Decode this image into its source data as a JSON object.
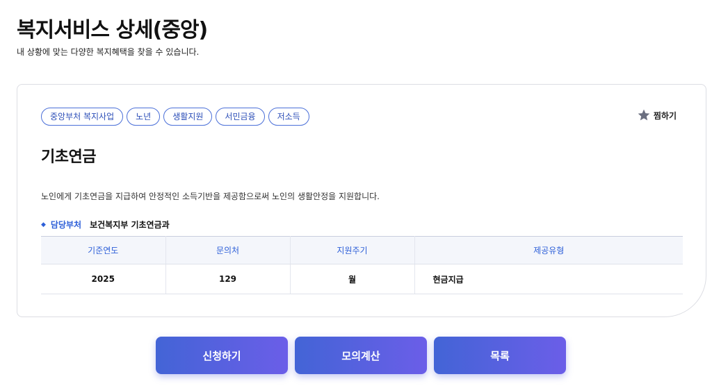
{
  "header": {
    "title": "복지서비스 상세(중앙)",
    "subtitle": "내 상황에 맞는 다양한 복지혜택을 찾을 수 있습니다."
  },
  "service": {
    "tags": [
      "중앙부처 복지사업",
      "노년",
      "생활지원",
      "서민금융",
      "저소득"
    ],
    "favorite_label": "찜하기",
    "favorite_icon": "star-icon",
    "title": "기초연금",
    "description": "노인에게 기초연금을 지급하여 안정적인 소득기반을 제공함으로써 노인의 생활안정을 지원합니다.",
    "department": {
      "label": "담당부처",
      "value": "보건복지부 기초연금과"
    },
    "table": {
      "headers": [
        "기준연도",
        "문의처",
        "지원주기",
        "제공유형"
      ],
      "rows": [
        [
          "2025",
          "129",
          "월",
          "현금지급"
        ]
      ]
    }
  },
  "buttons": {
    "apply": "신청하기",
    "simulate": "모의계산",
    "list": "목록"
  },
  "colors": {
    "accent": "#2d5fd8",
    "button_gradient_start": "#4364d6",
    "button_gradient_end": "#6b5ee8",
    "star": "#6b6f80"
  }
}
